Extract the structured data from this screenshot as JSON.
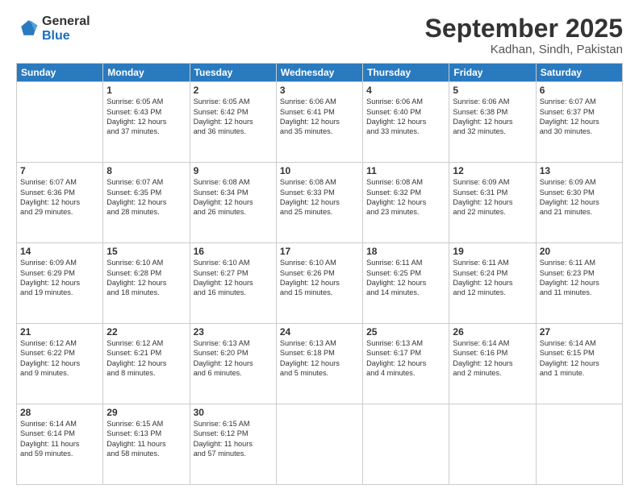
{
  "logo": {
    "general": "General",
    "blue": "Blue"
  },
  "header": {
    "title": "September 2025",
    "subtitle": "Kadhan, Sindh, Pakistan"
  },
  "weekdays": [
    "Sunday",
    "Monday",
    "Tuesday",
    "Wednesday",
    "Thursday",
    "Friday",
    "Saturday"
  ],
  "weeks": [
    [
      {
        "day": "",
        "info": ""
      },
      {
        "day": "1",
        "info": "Sunrise: 6:05 AM\nSunset: 6:43 PM\nDaylight: 12 hours\nand 37 minutes."
      },
      {
        "day": "2",
        "info": "Sunrise: 6:05 AM\nSunset: 6:42 PM\nDaylight: 12 hours\nand 36 minutes."
      },
      {
        "day": "3",
        "info": "Sunrise: 6:06 AM\nSunset: 6:41 PM\nDaylight: 12 hours\nand 35 minutes."
      },
      {
        "day": "4",
        "info": "Sunrise: 6:06 AM\nSunset: 6:40 PM\nDaylight: 12 hours\nand 33 minutes."
      },
      {
        "day": "5",
        "info": "Sunrise: 6:06 AM\nSunset: 6:38 PM\nDaylight: 12 hours\nand 32 minutes."
      },
      {
        "day": "6",
        "info": "Sunrise: 6:07 AM\nSunset: 6:37 PM\nDaylight: 12 hours\nand 30 minutes."
      }
    ],
    [
      {
        "day": "7",
        "info": "Sunrise: 6:07 AM\nSunset: 6:36 PM\nDaylight: 12 hours\nand 29 minutes."
      },
      {
        "day": "8",
        "info": "Sunrise: 6:07 AM\nSunset: 6:35 PM\nDaylight: 12 hours\nand 28 minutes."
      },
      {
        "day": "9",
        "info": "Sunrise: 6:08 AM\nSunset: 6:34 PM\nDaylight: 12 hours\nand 26 minutes."
      },
      {
        "day": "10",
        "info": "Sunrise: 6:08 AM\nSunset: 6:33 PM\nDaylight: 12 hours\nand 25 minutes."
      },
      {
        "day": "11",
        "info": "Sunrise: 6:08 AM\nSunset: 6:32 PM\nDaylight: 12 hours\nand 23 minutes."
      },
      {
        "day": "12",
        "info": "Sunrise: 6:09 AM\nSunset: 6:31 PM\nDaylight: 12 hours\nand 22 minutes."
      },
      {
        "day": "13",
        "info": "Sunrise: 6:09 AM\nSunset: 6:30 PM\nDaylight: 12 hours\nand 21 minutes."
      }
    ],
    [
      {
        "day": "14",
        "info": "Sunrise: 6:09 AM\nSunset: 6:29 PM\nDaylight: 12 hours\nand 19 minutes."
      },
      {
        "day": "15",
        "info": "Sunrise: 6:10 AM\nSunset: 6:28 PM\nDaylight: 12 hours\nand 18 minutes."
      },
      {
        "day": "16",
        "info": "Sunrise: 6:10 AM\nSunset: 6:27 PM\nDaylight: 12 hours\nand 16 minutes."
      },
      {
        "day": "17",
        "info": "Sunrise: 6:10 AM\nSunset: 6:26 PM\nDaylight: 12 hours\nand 15 minutes."
      },
      {
        "day": "18",
        "info": "Sunrise: 6:11 AM\nSunset: 6:25 PM\nDaylight: 12 hours\nand 14 minutes."
      },
      {
        "day": "19",
        "info": "Sunrise: 6:11 AM\nSunset: 6:24 PM\nDaylight: 12 hours\nand 12 minutes."
      },
      {
        "day": "20",
        "info": "Sunrise: 6:11 AM\nSunset: 6:23 PM\nDaylight: 12 hours\nand 11 minutes."
      }
    ],
    [
      {
        "day": "21",
        "info": "Sunrise: 6:12 AM\nSunset: 6:22 PM\nDaylight: 12 hours\nand 9 minutes."
      },
      {
        "day": "22",
        "info": "Sunrise: 6:12 AM\nSunset: 6:21 PM\nDaylight: 12 hours\nand 8 minutes."
      },
      {
        "day": "23",
        "info": "Sunrise: 6:13 AM\nSunset: 6:20 PM\nDaylight: 12 hours\nand 6 minutes."
      },
      {
        "day": "24",
        "info": "Sunrise: 6:13 AM\nSunset: 6:18 PM\nDaylight: 12 hours\nand 5 minutes."
      },
      {
        "day": "25",
        "info": "Sunrise: 6:13 AM\nSunset: 6:17 PM\nDaylight: 12 hours\nand 4 minutes."
      },
      {
        "day": "26",
        "info": "Sunrise: 6:14 AM\nSunset: 6:16 PM\nDaylight: 12 hours\nand 2 minutes."
      },
      {
        "day": "27",
        "info": "Sunrise: 6:14 AM\nSunset: 6:15 PM\nDaylight: 12 hours\nand 1 minute."
      }
    ],
    [
      {
        "day": "28",
        "info": "Sunrise: 6:14 AM\nSunset: 6:14 PM\nDaylight: 11 hours\nand 59 minutes."
      },
      {
        "day": "29",
        "info": "Sunrise: 6:15 AM\nSunset: 6:13 PM\nDaylight: 11 hours\nand 58 minutes."
      },
      {
        "day": "30",
        "info": "Sunrise: 6:15 AM\nSunset: 6:12 PM\nDaylight: 11 hours\nand 57 minutes."
      },
      {
        "day": "",
        "info": ""
      },
      {
        "day": "",
        "info": ""
      },
      {
        "day": "",
        "info": ""
      },
      {
        "day": "",
        "info": ""
      }
    ]
  ]
}
